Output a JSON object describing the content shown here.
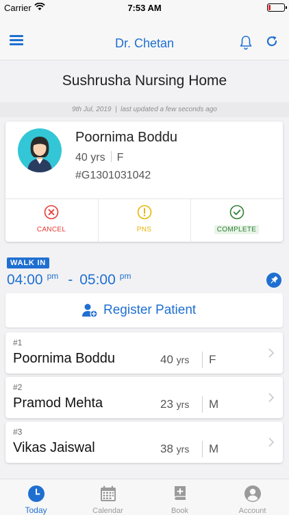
{
  "status_bar": {
    "carrier": "Carrier",
    "time": "7:53 AM"
  },
  "header": {
    "title": "Dr. Chetan",
    "menu_icon": "hamburger-icon",
    "notification_icon": "bell-icon",
    "refresh_icon": "refresh-icon"
  },
  "clinic_name": "Sushrusha Nursing Home",
  "update_info": {
    "date": "9th Jul, 2019",
    "separator": "|",
    "status": "last updated a few seconds ago"
  },
  "current_patient": {
    "name": "Poornima Boddu",
    "age": "40 yrs",
    "gender": "F",
    "id": "#G1301031042",
    "actions": [
      {
        "label": "CANCEL",
        "icon": "x-circle-icon",
        "color": "#e53935"
      },
      {
        "label": "PNS",
        "icon": "exclamation-circle-icon",
        "color": "#e9b400"
      },
      {
        "label": "COMPLETE",
        "icon": "check-circle-icon",
        "color": "#2e7d32"
      }
    ]
  },
  "slot": {
    "badge": "WALK IN",
    "start": "04:00",
    "start_suffix": "pm",
    "dash": "-",
    "end": "05:00",
    "end_suffix": "pm",
    "pin_icon": "pin-icon"
  },
  "register_button": {
    "label": "Register Patient",
    "icon": "add-user-icon"
  },
  "queue": [
    {
      "number": "#1",
      "name": "Poornima Boddu",
      "age": "40",
      "unit": "yrs",
      "gender": "F"
    },
    {
      "number": "#2",
      "name": "Pramod Mehta",
      "age": "23",
      "unit": "yrs",
      "gender": "M"
    },
    {
      "number": "#3",
      "name": "Vikas Jaiswal",
      "age": "38",
      "unit": "yrs",
      "gender": "M"
    }
  ],
  "tabs": [
    {
      "label": "Today",
      "icon": "clock-icon",
      "active": true
    },
    {
      "label": "Calendar",
      "icon": "calendar-icon",
      "active": false
    },
    {
      "label": "Book",
      "icon": "book-icon",
      "active": false
    },
    {
      "label": "Account",
      "icon": "user-icon",
      "active": false
    }
  ],
  "colors": {
    "accent": "#1f6fd1",
    "cancel": "#e53935",
    "pns": "#e9b400",
    "complete": "#2e7d32",
    "background": "#f2f2f4"
  }
}
